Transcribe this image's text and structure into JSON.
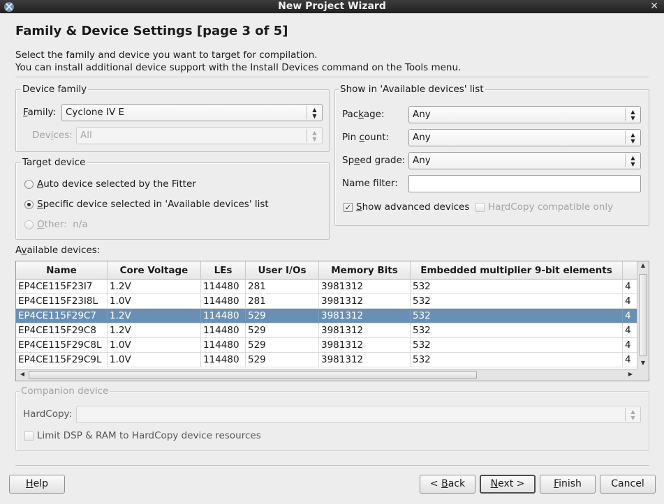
{
  "window": {
    "title": "New Project Wizard",
    "close_glyph": "✕"
  },
  "page": {
    "heading": "Family & Device Settings [page 3 of 5]",
    "desc_line1": "Select the family and device you want to target for compilation.",
    "desc_line2": "You can install additional device support with the Install Devices command on the Tools menu."
  },
  "device_family": {
    "title": "Device family",
    "family_label": "Family:",
    "family_value": "Cyclone IV E",
    "devices_label": "Devices:",
    "devices_value": "All"
  },
  "target_device": {
    "title": "Target device",
    "options": [
      {
        "label": "Auto device selected by the Fitter",
        "checked": false,
        "enabled": true
      },
      {
        "label": "Specific device selected in 'Available devices' list",
        "checked": true,
        "enabled": true
      },
      {
        "label": "Other:  n/a",
        "checked": false,
        "enabled": false
      }
    ]
  },
  "show_in_list": {
    "title": "Show in 'Available devices' list",
    "package_label": "Package:",
    "package_value": "Any",
    "pin_count_label": "Pin count:",
    "pin_count_value": "Any",
    "speed_grade_label": "Speed grade:",
    "speed_grade_value": "Any",
    "name_filter_label": "Name filter:",
    "name_filter_value": "",
    "show_advanced_label": "Show advanced devices",
    "show_advanced_checked": true,
    "hardcopy_only_label": "HardCopy compatible only",
    "hardcopy_only_checked": false
  },
  "available_devices": {
    "label": "Available devices:",
    "columns": [
      "Name",
      "Core Voltage",
      "LEs",
      "User I/Os",
      "Memory Bits",
      "Embedded multiplier 9-bit elements",
      ""
    ],
    "rows": [
      [
        "EP4CE115F23I7",
        "1.2V",
        "114480",
        "281",
        "3981312",
        "532",
        "4"
      ],
      [
        "EP4CE115F23I8L",
        "1.0V",
        "114480",
        "281",
        "3981312",
        "532",
        "4"
      ],
      [
        "EP4CE115F29C7",
        "1.2V",
        "114480",
        "529",
        "3981312",
        "532",
        "4"
      ],
      [
        "EP4CE115F29C8",
        "1.2V",
        "114480",
        "529",
        "3981312",
        "532",
        "4"
      ],
      [
        "EP4CE115F29C8L",
        "1.0V",
        "114480",
        "529",
        "3981312",
        "532",
        "4"
      ],
      [
        "EP4CE115F29C9L",
        "1.0V",
        "114480",
        "529",
        "3981312",
        "532",
        "4"
      ]
    ],
    "selected_row": 2,
    "selection_color": "#6a8fb4"
  },
  "companion_device": {
    "title": "Companion device",
    "hardcopy_label": "HardCopy:",
    "hardcopy_value": "",
    "limit_label": "Limit DSP & RAM to HardCopy device resources"
  },
  "buttons": {
    "help": "Help",
    "back": "< Back",
    "next": "Next >",
    "finish": "Finish",
    "cancel": "Cancel"
  }
}
